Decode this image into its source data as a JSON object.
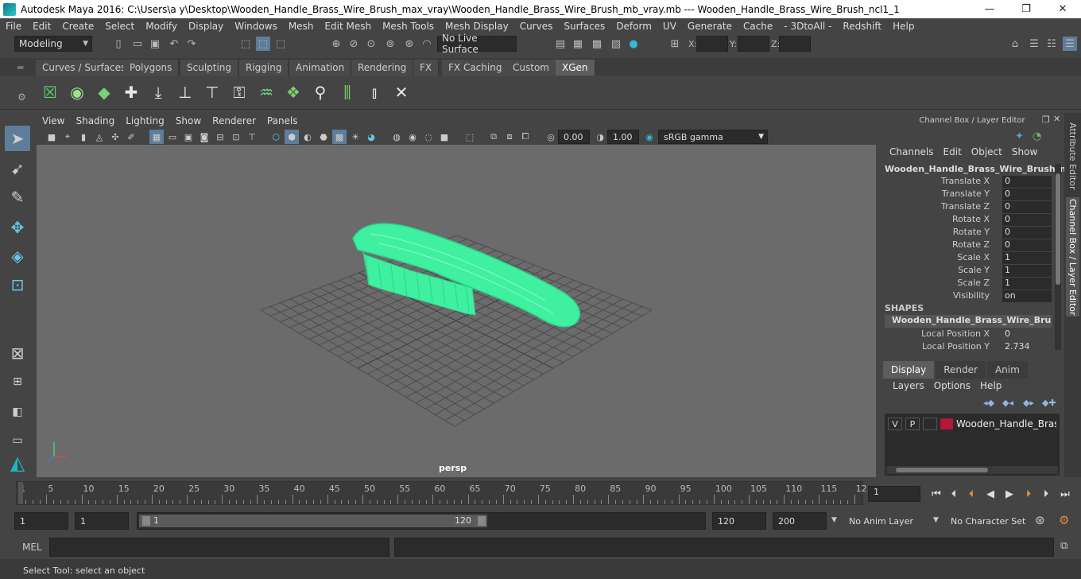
{
  "window": {
    "title": "Autodesk Maya 2016: C:\\Users\\a y\\Desktop\\Wooden_Handle_Brass_Wire_Brush_max_vray\\Wooden_Handle_Brass_Wire_Brush_mb_vray.mb   ---   Wooden_Handle_Brass_Wire_Brush_ncl1_1",
    "minimize": "—",
    "maximize": "❐",
    "close": "✕"
  },
  "menubar": [
    "File",
    "Edit",
    "Create",
    "Select",
    "Modify",
    "Display",
    "Windows",
    "Mesh",
    "Edit Mesh",
    "Mesh Tools",
    "Mesh Display",
    "Curves",
    "Surfaces",
    "Deform",
    "UV",
    "Generate",
    "Cache",
    "- 3DtoAll -",
    "Redshift",
    "Help"
  ],
  "statusline": {
    "mode": "Modeling",
    "live_surface": "No Live Surface",
    "x_label": "X:",
    "y_label": "Y:",
    "z_label": "Z:"
  },
  "shelf_tabs": [
    "Curves / Surfaces",
    "Polygons",
    "Sculpting",
    "Rigging",
    "Animation",
    "Rendering",
    "FX",
    "FX Caching",
    "Custom",
    "XGen"
  ],
  "shelf_active": "XGen",
  "viewport": {
    "menu": [
      "View",
      "Shading",
      "Lighting",
      "Show",
      "Renderer",
      "Panels"
    ],
    "exposure": "0.00",
    "gamma": "1.00",
    "color_space": "sRGB gamma",
    "camera": "persp",
    "mesh_color": "#4dffb0"
  },
  "channel_box": {
    "header": "Channel Box / Layer Editor",
    "menu": [
      "Channels",
      "Edit",
      "Object",
      "Show"
    ],
    "object_name": "Wooden_Handle_Brass_Wire_Brush_n...",
    "channels": [
      {
        "label": "Translate X",
        "value": "0"
      },
      {
        "label": "Translate Y",
        "value": "0"
      },
      {
        "label": "Translate Z",
        "value": "0"
      },
      {
        "label": "Rotate X",
        "value": "0"
      },
      {
        "label": "Rotate Y",
        "value": "0"
      },
      {
        "label": "Rotate Z",
        "value": "0"
      },
      {
        "label": "Scale X",
        "value": "1"
      },
      {
        "label": "Scale Y",
        "value": "1"
      },
      {
        "label": "Scale Z",
        "value": "1"
      },
      {
        "label": "Visibility",
        "value": "on"
      }
    ],
    "shapes_label": "SHAPES",
    "shape_name": "Wooden_Handle_Brass_Wire_Brush_...",
    "shape_channels": [
      {
        "label": "Local Position X",
        "value": "0"
      },
      {
        "label": "Local Position Y",
        "value": "2.734"
      }
    ]
  },
  "layer_editor": {
    "tabs": [
      "Display",
      "Render",
      "Anim"
    ],
    "active_tab": "Display",
    "menu": [
      "Layers",
      "Options",
      "Help"
    ],
    "layer": {
      "v": "V",
      "p": "P",
      "name": "Wooden_Handle_Brass_Wire_Brush",
      "color": "#b5163a"
    }
  },
  "side_tabs": [
    "Attribute Editor",
    "Channel Box / Layer Editor"
  ],
  "timeslider": {
    "ticks": [
      "1",
      "5",
      "10",
      "15",
      "20",
      "25",
      "30",
      "35",
      "40",
      "45",
      "50",
      "55",
      "60",
      "65",
      "70",
      "75",
      "80",
      "85",
      "90",
      "95",
      "100",
      "105",
      "110",
      "115",
      "12"
    ],
    "current_frame": "1"
  },
  "range": {
    "start": "1",
    "playback_start": "1",
    "range_start_label": "1",
    "range_end_label": "120",
    "playback_end": "120",
    "end": "200",
    "anim_layer": "No Anim Layer",
    "character_set": "No Character Set"
  },
  "cmdline": {
    "label": "MEL"
  },
  "helpline": "Select Tool: select an object"
}
